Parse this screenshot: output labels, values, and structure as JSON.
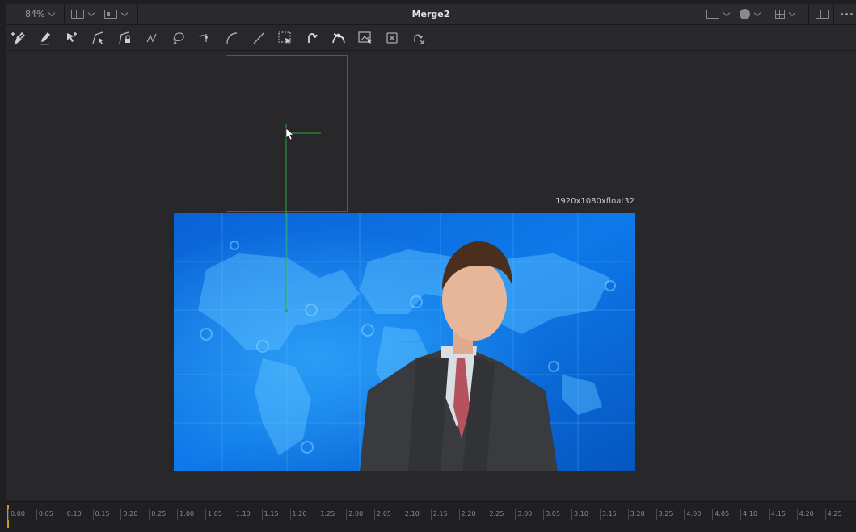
{
  "window": {
    "zoom": "84%",
    "node_title": "Merge2"
  },
  "toolbar": {
    "tools": [
      "pen-add-icon",
      "pencil-icon",
      "select-add-icon",
      "select-polyline-icon",
      "select-lock-icon",
      "polyline-icon",
      "bspline-loop-icon",
      "smooth-icon",
      "curve-icon",
      "line-icon",
      "select-box-icon",
      "reverse-icon",
      "bezier-handle-icon",
      "shape-box-icon",
      "delete-point-icon",
      "stop-render-icon"
    ]
  },
  "viewer": {
    "resolution_label": "1920x1080xfloat32"
  },
  "timeline": {
    "ticks": [
      "0:00",
      "0:05",
      "0:10",
      "0:15",
      "0:20",
      "0:25",
      "1:00",
      "1:05",
      "1:10",
      "1:15",
      "1:20",
      "1:25",
      "2:00",
      "2:05",
      "2:10",
      "2:15",
      "2:20",
      "2:25",
      "3:00",
      "3:05",
      "3:10",
      "3:15",
      "3:20",
      "3:25",
      "4:00",
      "4:05",
      "4:10",
      "4:15",
      "4:20",
      "4:25"
    ]
  },
  "colors": {
    "accent_green": "#2fa83c",
    "playhead": "#c79a1c",
    "frame_blue": "#0b5bc4"
  }
}
